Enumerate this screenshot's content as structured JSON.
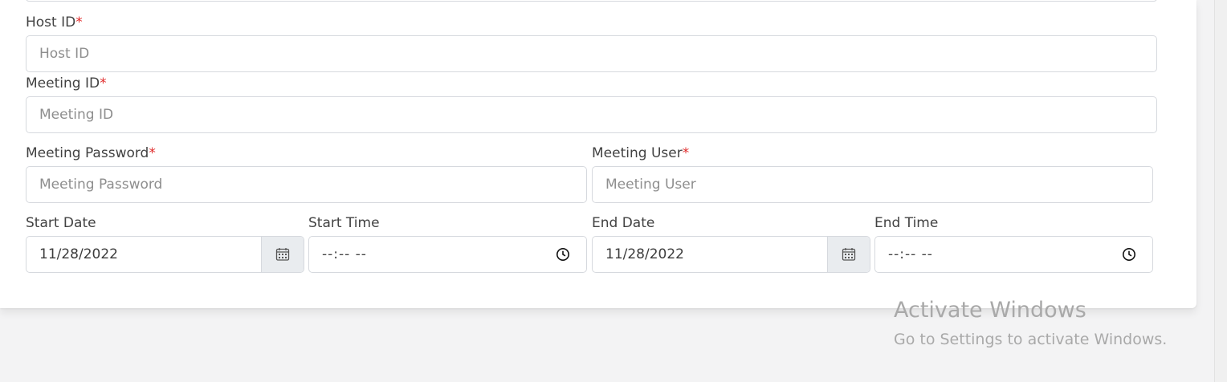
{
  "form": {
    "host_id": {
      "label": "Host ID",
      "required_mark": "*",
      "placeholder": "Host ID"
    },
    "meeting_id": {
      "label": "Meeting ID",
      "required_mark": "*",
      "placeholder": "Meeting ID"
    },
    "meeting_password": {
      "label": "Meeting Password",
      "required_mark": "*",
      "placeholder": "Meeting Password"
    },
    "meeting_user": {
      "label": "Meeting User",
      "required_mark": "*",
      "placeholder": "Meeting User"
    },
    "start_date": {
      "label": "Start Date",
      "value": "11/28/2022",
      "icon": "calendar-icon"
    },
    "start_time": {
      "label": "Start Time",
      "value": "--:-- --",
      "icon": "clock-icon"
    },
    "end_date": {
      "label": "End Date",
      "value": "11/28/2022",
      "icon": "calendar-icon"
    },
    "end_time": {
      "label": "End Time",
      "value": "--:-- --",
      "icon": "clock-icon"
    }
  },
  "watermark": {
    "title": "Activate Windows",
    "subtitle": "Go to Settings to activate Windows."
  },
  "colors": {
    "required": "#e02b2b",
    "border": "#d6d9de",
    "addon_bg": "#e9ecef"
  }
}
